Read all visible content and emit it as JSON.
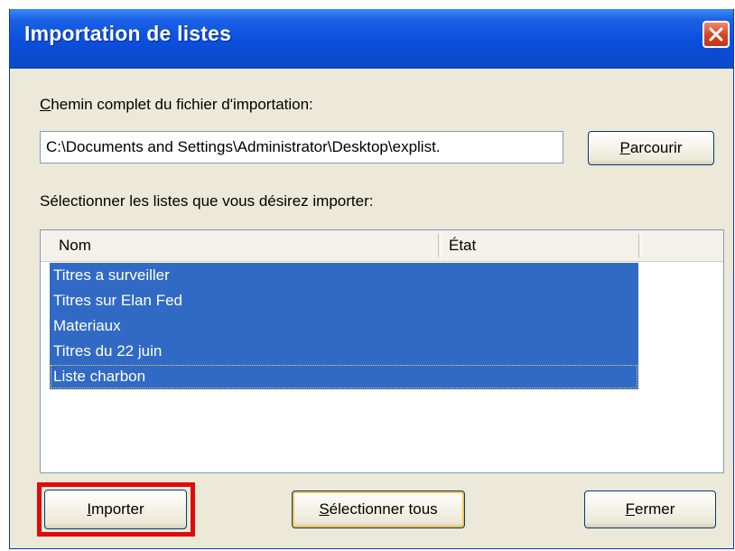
{
  "window": {
    "title": "Importation de listes",
    "close_icon": "close-icon",
    "accent": "#0a4fdc"
  },
  "path_section": {
    "label_first": "C",
    "label_rest": "hemin complet du fichier d'importation:",
    "value": "C:\\Documents and Settings\\Administrator\\Desktop\\explist.",
    "browse_first": "P",
    "browse_rest": "arcourir"
  },
  "lists_section": {
    "label": "Sélectionner les listes que vous désirez importer:",
    "columns": [
      "Nom",
      "État"
    ],
    "items": [
      "Titres a surveiller",
      "Titres sur Elan Fed",
      "Materiaux",
      "Titres du 22 juin",
      "Liste charbon"
    ],
    "selection_color": "#316ac5"
  },
  "footer": {
    "import_first": "I",
    "import_rest": "mporter",
    "select_all_first": "S",
    "select_all_rest": "électionner tous",
    "close_first": "F",
    "close_rest": "ermer",
    "highlight_color": "#e10b0b"
  }
}
